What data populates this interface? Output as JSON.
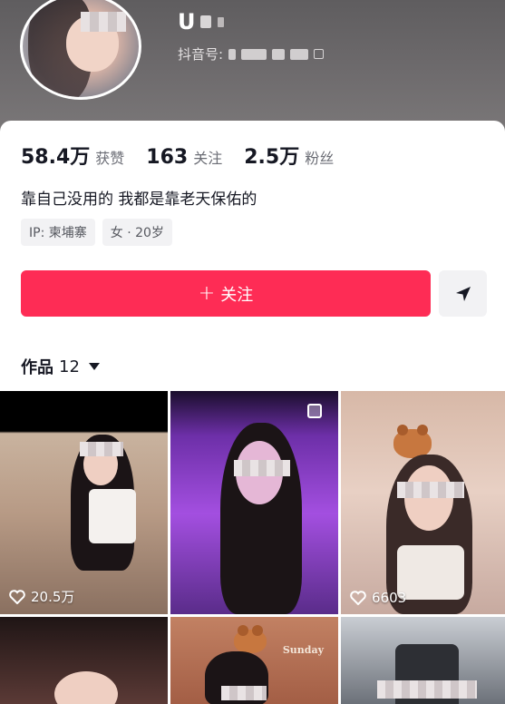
{
  "profile": {
    "username": "U",
    "douyin_id_label": "抖音号:"
  },
  "stats": {
    "likes_value": "58.4万",
    "likes_label": "获赞",
    "following_value": "163",
    "following_label": "关注",
    "followers_value": "2.5万",
    "followers_label": "粉丝"
  },
  "bio": "靠自己没用的 我都是靠老天保佑的",
  "tags": {
    "ip": "IP: 柬埔寨",
    "gender_age": "女 · 20岁"
  },
  "actions": {
    "follow_label": "关注",
    "follow_icon": "plus-icon",
    "share_icon": "send-arrow-icon"
  },
  "works": {
    "label": "作品",
    "count": "12"
  },
  "videos": [
    {
      "likes": "20.5万"
    },
    {
      "likes": ""
    },
    {
      "likes": "6603"
    }
  ],
  "sticker_text": "Sunday",
  "colors": {
    "accent": "#fe2c55",
    "text_primary": "#161823",
    "text_secondary": "#6b6d75",
    "tag_bg": "#f2f2f4"
  }
}
